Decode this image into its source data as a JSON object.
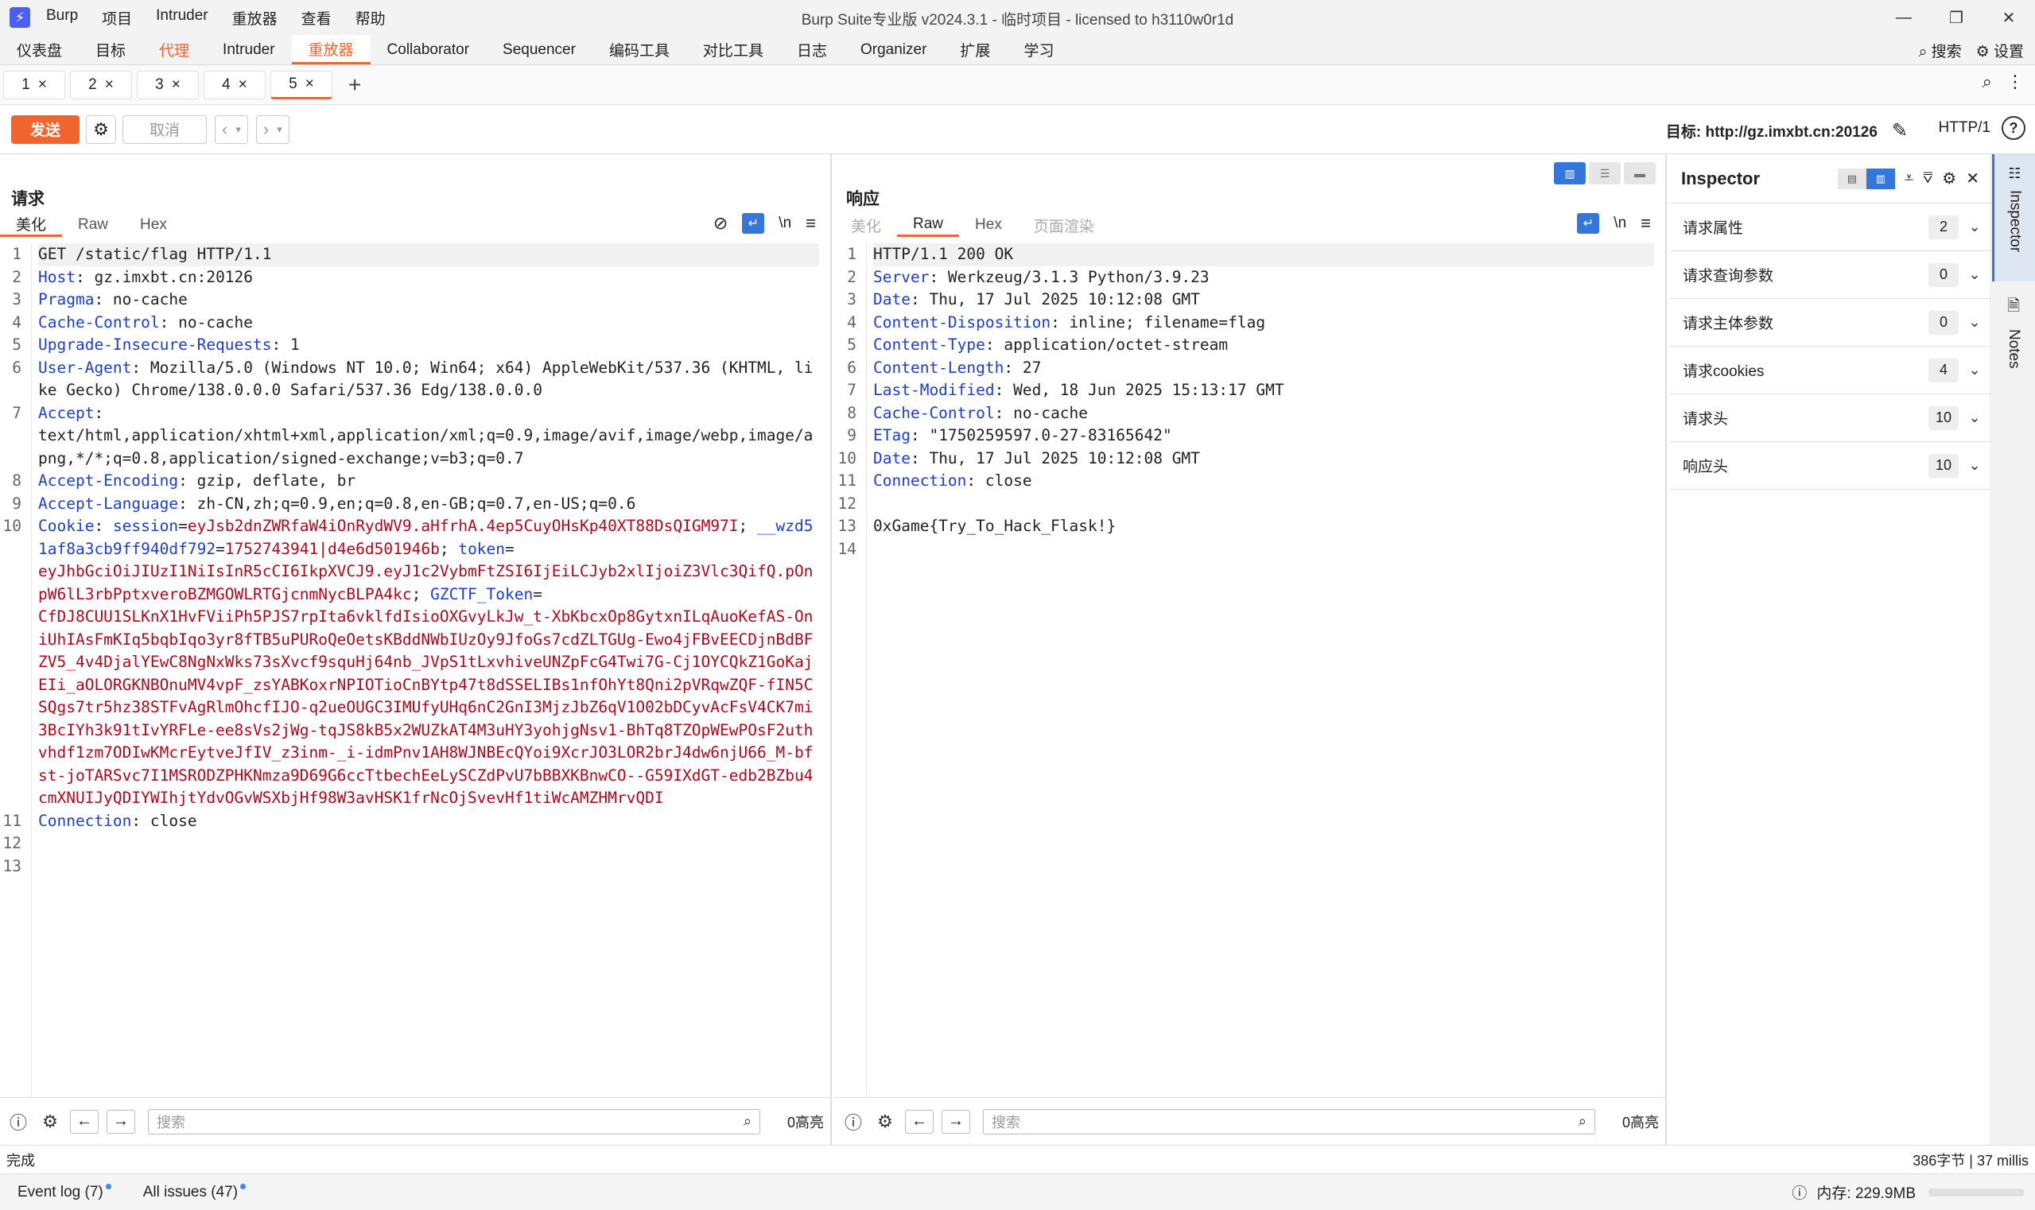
{
  "titlebar": {
    "logo": "⚡",
    "menus": [
      "Burp",
      "项目",
      "Intruder",
      "重放器",
      "查看",
      "帮助"
    ],
    "title": "Burp Suite专业版  v2024.3.1 - 临时项目 - licensed to h3110w0r1d",
    "controls": [
      "—",
      "❐",
      "✕"
    ]
  },
  "main_tabs": [
    {
      "label": "仪表盘",
      "state": "normal"
    },
    {
      "label": "目标",
      "state": "normal"
    },
    {
      "label": "代理",
      "state": "orange"
    },
    {
      "label": "Intruder",
      "state": "normal"
    },
    {
      "label": "重放器",
      "state": "active"
    },
    {
      "label": "Collaborator",
      "state": "normal"
    },
    {
      "label": "Sequencer",
      "state": "normal"
    },
    {
      "label": "编码工具",
      "state": "normal"
    },
    {
      "label": "对比工具",
      "state": "normal"
    },
    {
      "label": "日志",
      "state": "normal"
    },
    {
      "label": "Organizer",
      "state": "normal"
    },
    {
      "label": "扩展",
      "state": "normal"
    },
    {
      "label": "学习",
      "state": "normal"
    }
  ],
  "main_right": {
    "search": "搜索",
    "settings": "设置"
  },
  "sub_tabs": [
    {
      "label": "1",
      "active": false
    },
    {
      "label": "2",
      "active": false
    },
    {
      "label": "3",
      "active": false
    },
    {
      "label": "4",
      "active": false
    },
    {
      "label": "5",
      "active": true
    }
  ],
  "toolbar": {
    "send": "发送",
    "cancel": "取消",
    "target_label": "目标: http://gz.imxbt.cn:20126",
    "http_version": "HTTP/1"
  },
  "request": {
    "heading": "请求",
    "tabs": [
      "美化",
      "Raw",
      "Hex"
    ],
    "active_tab": 0,
    "lines": [
      [
        [
          "",
          "GET /static/flag HTTP/1.1"
        ]
      ],
      [
        [
          "k",
          "Host"
        ],
        [
          "",
          ": gz.imxbt.cn:20126"
        ]
      ],
      [
        [
          "k",
          "Pragma"
        ],
        [
          "",
          ": no-cache"
        ]
      ],
      [
        [
          "k",
          "Cache-Control"
        ],
        [
          "",
          ": no-cache"
        ]
      ],
      [
        [
          "k",
          "Upgrade-Insecure-Requests"
        ],
        [
          "",
          ": 1"
        ]
      ],
      [
        [
          "k",
          "User-Agent"
        ],
        [
          "",
          ": Mozilla/5.0 (Windows NT 10.0; Win64; x64) AppleWebKit/537.36 (KHTML, like Gecko) Chrome/138.0.0.0 Safari/537.36 Edg/138.0.0.0"
        ]
      ],
      [
        [
          "k",
          "Accept"
        ],
        [
          "",
          ":\ntext/html,application/xhtml+xml,application/xml;q=0.9,image/avif,image/webp,image/apng,*/*;q=0.8,application/signed-exchange;v=b3;q=0.7"
        ]
      ],
      [
        [
          "k",
          "Accept-Encoding"
        ],
        [
          "",
          ": gzip, deflate, br"
        ]
      ],
      [
        [
          "k",
          "Accept-Language"
        ],
        [
          "",
          ": zh-CN,zh;q=0.9,en;q=0.8,en-GB;q=0.7,en-US;q=0.6"
        ]
      ],
      [
        [
          "k",
          "Cookie"
        ],
        [
          "",
          ": "
        ],
        [
          "c",
          "session"
        ],
        [
          "",
          "="
        ],
        [
          "v",
          "eyJsb2dnZWRfaW4iOnRydWV9.aHfrhA.4ep5CuyOHsKp40XT88DsQIGM97I"
        ],
        [
          "",
          "; "
        ],
        [
          "c",
          "__wzd51af8a3cb9ff940df792"
        ],
        [
          "",
          "="
        ],
        [
          "v",
          "1752743941|d4e6d501946b"
        ],
        [
          "",
          "; "
        ],
        [
          "c",
          "token"
        ],
        [
          "",
          "=\n"
        ],
        [
          "v",
          "eyJhbGciOiJIUzI1NiIsInR5cCI6IkpXVCJ9.eyJ1c2VybmFtZSI6IjEiLCJyb2xlIjoiZ3Vlc3QifQ.pOnpW6lL3rbPptxveroBZMGOWLRTGjcnmNycBLPA4kc"
        ],
        [
          "",
          "; "
        ],
        [
          "c",
          "GZCTF_Token"
        ],
        [
          "",
          "=\n"
        ],
        [
          "v",
          "CfDJ8CUU1SLKnX1HvFViiPh5PJS7rpIta6vklfdIsioOXGvyLkJw_t-XbKbcxOp8GytxnILqAuoKefAS-OniUhIAsFmKIq5bqbIqo3yr8fTB5uPURoQeOetsKBddNWbIUzOy9JfoGs7cdZLTGUg-Ewo4jFBvEECDjnBdBFZV5_4v4DjalYEwC8NgNxWks73sXvcf9squHj64nb_JVpS1tLxvhiveUNZpFcG4Twi7G-Cj1OYCQkZ1GoKajEIi_aOLORGKNBOnuMV4vpF_zsYABKoxrNPIOTioCnBYtp47t8dSSELIBs1nfOhYt8Qni2pVRqwZQF-fIN5CSQgs7tr5hz38STFvAgRlmOhcfIJO-q2ueOUGC3IMUfyUHq6nC2GnI3MjzJbZ6qV1O02bDCyvAcFsV4CK7mi3BcIYh3k91tIvYRFLe-ee8sVs2jWg-tqJS8kB5x2WUZkAT4M3uHY3yohjgNsv1-BhTq8TZOpWEwPOsF2uthvhdf1zm7ODIwKMcrEytveJfIV_z3inm-_i-idmPnv1AH8WJNBEcQYoi9XcrJO3LOR2brJ4dw6njU66_M-bfst-joTARSvc7I1MSRODZPHKNmza9D69G6ccTtbechEeLySCZdPvU7bBBXKBnwCO--G59IXdGT-edb2BZbu4cmXNUIJyQDIYWIhjtYdvOGvWSXbjHf98W3avHSK1frNcOjSvevHf1tiWcAMZHMrvQDI"
        ]
      ],
      [
        [
          "k",
          "Connection"
        ],
        [
          "",
          ": close"
        ]
      ],
      [
        [
          "",
          ""
        ]
      ],
      [
        [
          "",
          ""
        ]
      ]
    ],
    "search_placeholder": "搜索",
    "highlights": "0高亮"
  },
  "response": {
    "heading": "响应",
    "tabs": [
      "美化",
      "Raw",
      "Hex",
      "页面渲染"
    ],
    "active_tab": 1,
    "lines": [
      [
        [
          "",
          "HTTP/1.1 200 OK"
        ]
      ],
      [
        [
          "k",
          "Server"
        ],
        [
          "",
          ": Werkzeug/3.1.3 Python/3.9.23"
        ]
      ],
      [
        [
          "k",
          "Date"
        ],
        [
          "",
          ": Thu, 17 Jul 2025 10:12:08 GMT"
        ]
      ],
      [
        [
          "k",
          "Content-Disposition"
        ],
        [
          "",
          ": inline; filename=flag"
        ]
      ],
      [
        [
          "k",
          "Content-Type"
        ],
        [
          "",
          ": application/octet-stream"
        ]
      ],
      [
        [
          "k",
          "Content-Length"
        ],
        [
          "",
          ": 27"
        ]
      ],
      [
        [
          "k",
          "Last-Modified"
        ],
        [
          "",
          ": Wed, 18 Jun 2025 15:13:17 GMT"
        ]
      ],
      [
        [
          "k",
          "Cache-Control"
        ],
        [
          "",
          ": no-cache"
        ]
      ],
      [
        [
          "k",
          "ETag"
        ],
        [
          "",
          ": \"1750259597.0-27-83165642\""
        ]
      ],
      [
        [
          "k",
          "Date"
        ],
        [
          "",
          ": Thu, 17 Jul 2025 10:12:08 GMT"
        ]
      ],
      [
        [
          "k",
          "Connection"
        ],
        [
          "",
          ": close"
        ]
      ],
      [
        [
          "",
          ""
        ]
      ],
      [
        [
          "",
          "0xGame{Try_To_Hack_Flask!}"
        ]
      ],
      [
        [
          "",
          ""
        ]
      ]
    ],
    "search_placeholder": "搜索",
    "highlights": "0高亮"
  },
  "inspector": {
    "title": "Inspector",
    "rows": [
      {
        "label": "请求属性",
        "count": "2"
      },
      {
        "label": "请求查询参数",
        "count": "0"
      },
      {
        "label": "请求主体参数",
        "count": "0"
      },
      {
        "label": "请求cookies",
        "count": "4"
      },
      {
        "label": "请求头",
        "count": "10"
      },
      {
        "label": "响应头",
        "count": "10"
      }
    ]
  },
  "rail": {
    "inspector": "Inspector",
    "notes": "Notes"
  },
  "status": {
    "left": "完成",
    "right": "386字节 | 37 millis"
  },
  "bottom": {
    "event_log": "Event log (7)",
    "issues": "All issues (47)",
    "memory": "内存: 229.9MB"
  }
}
